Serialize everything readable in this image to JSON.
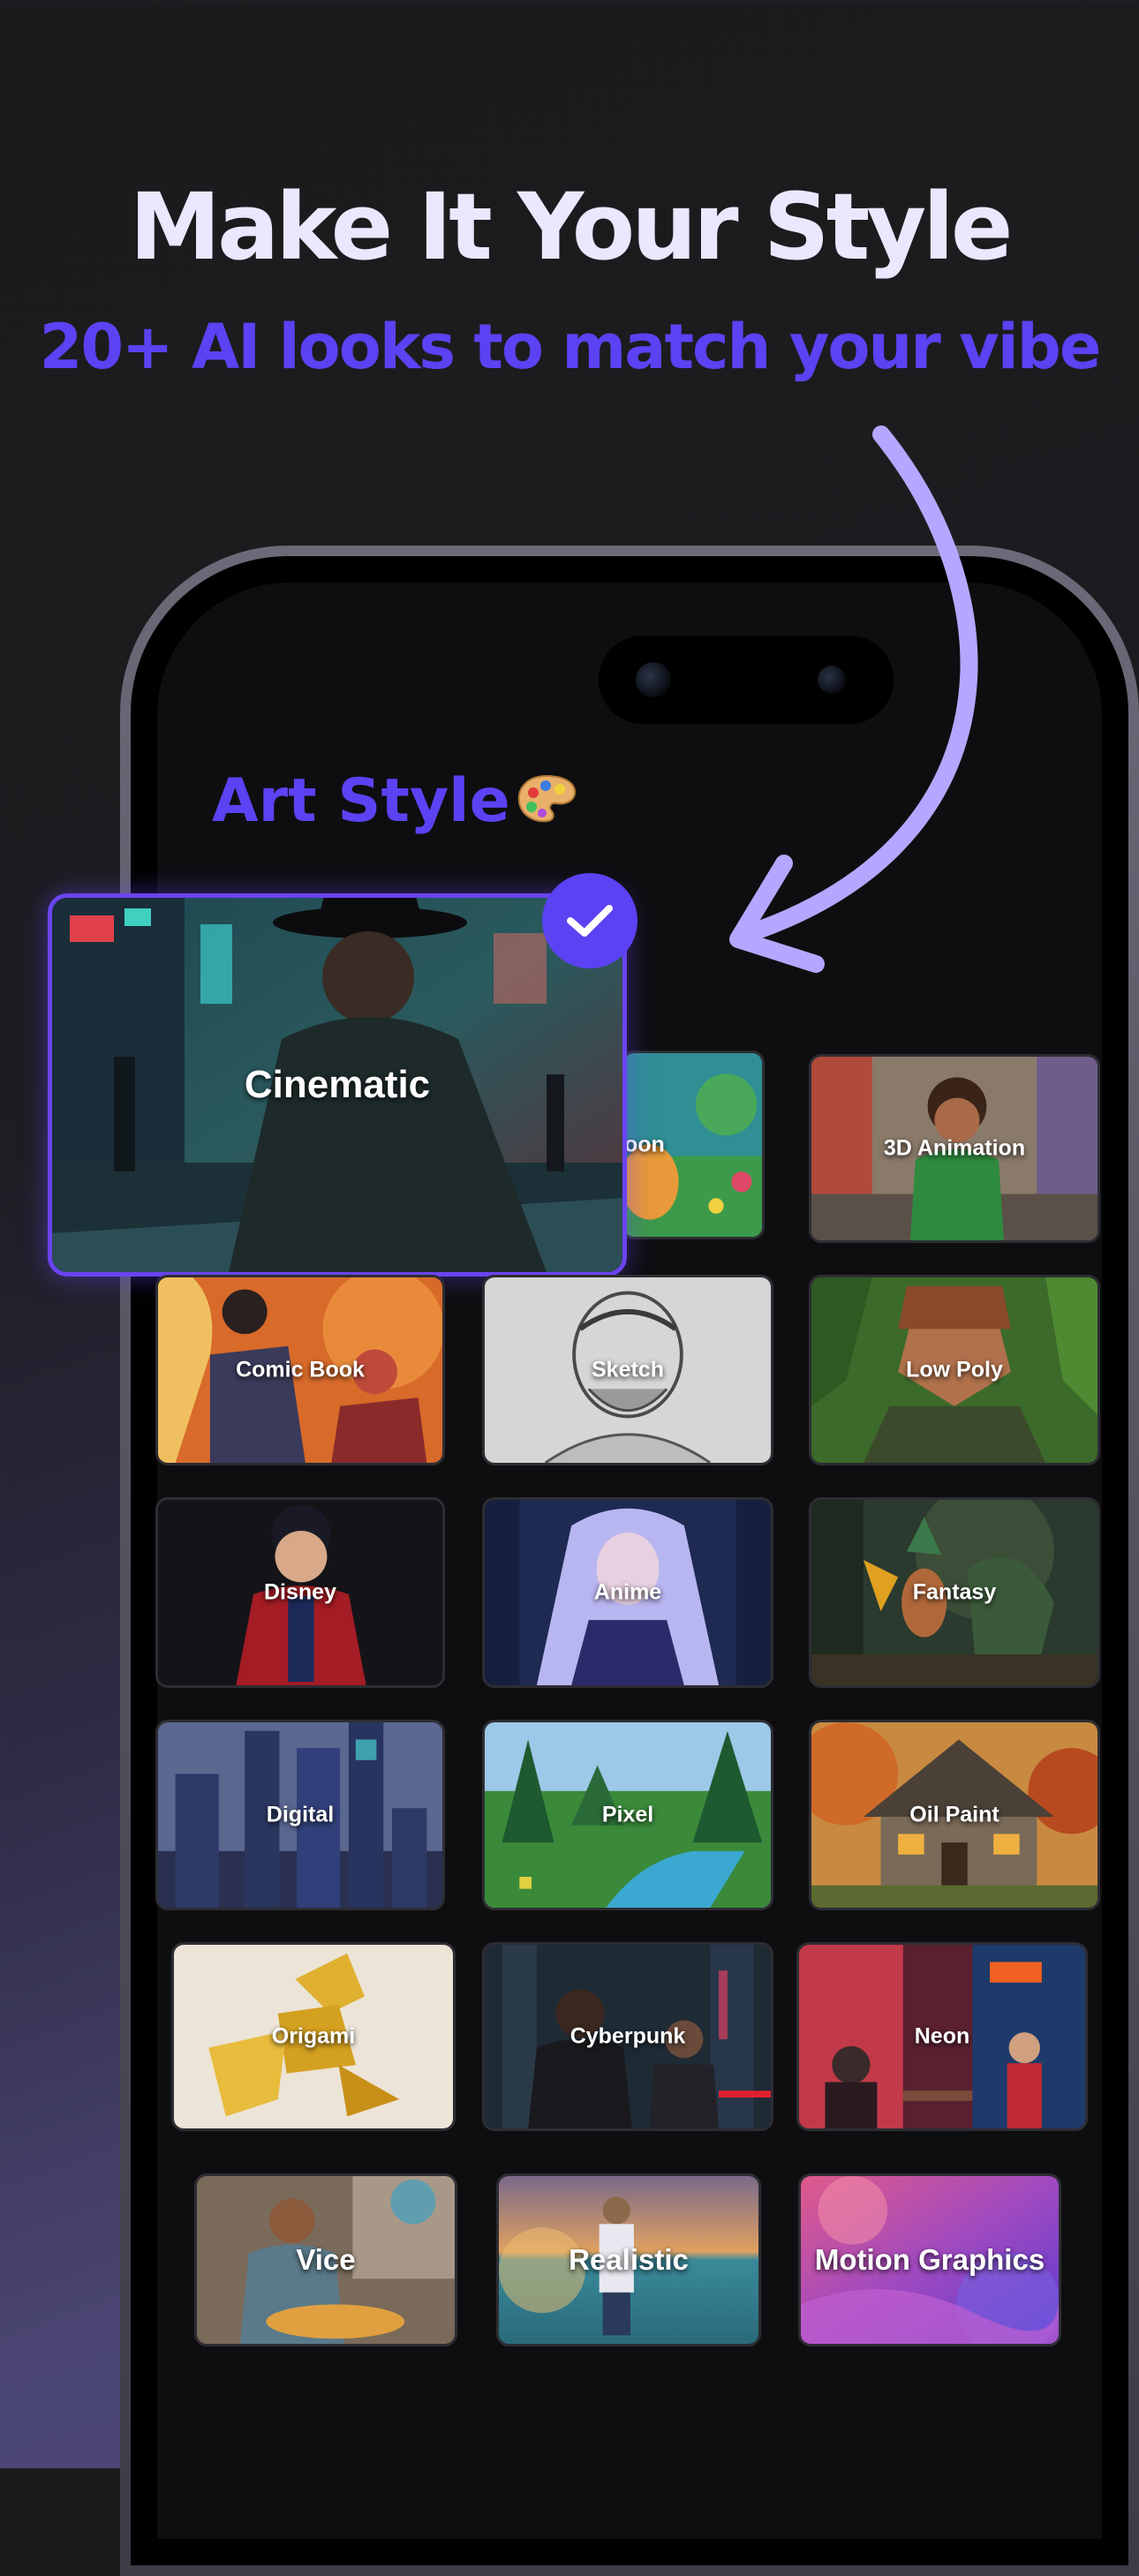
{
  "promo": {
    "headline": "Make It Your Style",
    "subheadline": "20+ AI looks to match your vibe"
  },
  "screen": {
    "title": "Art Style",
    "title_icon": "artist-palette-icon",
    "selected_style": "Cinematic"
  },
  "styles": [
    {
      "label": "Cinematic",
      "selected": true
    },
    {
      "label": "oon",
      "selected": false
    },
    {
      "label": "3D Animation",
      "selected": false
    },
    {
      "label": "Comic Book",
      "selected": false
    },
    {
      "label": "Sketch",
      "selected": false
    },
    {
      "label": "Low Poly",
      "selected": false
    },
    {
      "label": "Disney",
      "selected": false
    },
    {
      "label": "Anime",
      "selected": false
    },
    {
      "label": "Fantasy",
      "selected": false
    },
    {
      "label": "Digital",
      "selected": false
    },
    {
      "label": "Pixel",
      "selected": false
    },
    {
      "label": "Oil Paint",
      "selected": false
    },
    {
      "label": "Origami",
      "selected": false
    },
    {
      "label": "Cyberpunk",
      "selected": false
    },
    {
      "label": "Neon",
      "selected": false
    },
    {
      "label": "Vice",
      "selected": false
    },
    {
      "label": "Realistic",
      "selected": false
    },
    {
      "label": "Motion Graphics",
      "selected": false
    }
  ],
  "colors": {
    "accent": "#5b42f3",
    "headline": "#ece6ff",
    "arrow": "#b5a7ff",
    "screen_background": "#0e0e10"
  }
}
